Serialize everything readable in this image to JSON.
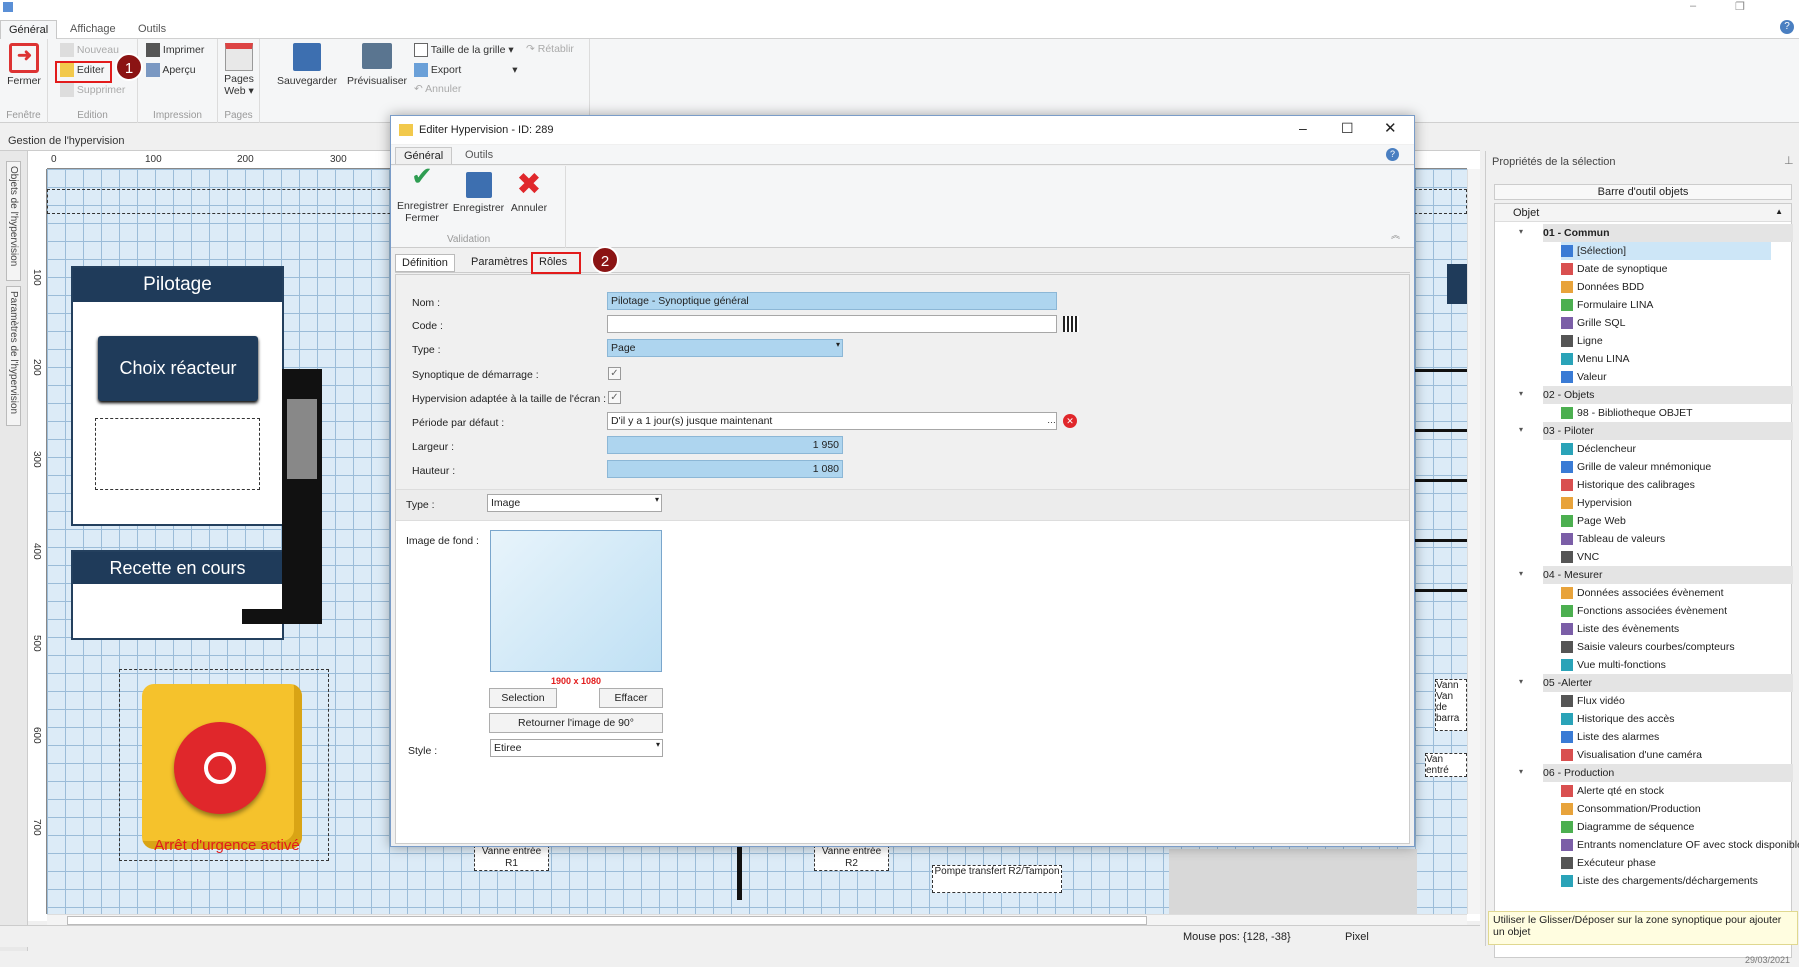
{
  "ribbon": {
    "tabs": [
      "Général",
      "Affichage",
      "Outils"
    ],
    "fermer": "Fermer",
    "nouveau": "Nouveau",
    "editer": "Editer",
    "supprimer": "Supprimer",
    "imprimer": "Imprimer",
    "apercu": "Aperçu",
    "pages_web": "Pages Web",
    "sauvegarder": "Sauvegarder",
    "previsualiser": "Prévisualiser",
    "taille_grille": "Taille de la grille",
    "export": "Export",
    "annuler": "Annuler",
    "retablir": "Rétablir",
    "groups": [
      "Fenêtre",
      "Edition",
      "Impression",
      "Pages"
    ]
  },
  "gestion": "Gestion de l'hypervision",
  "left_tabs": [
    "Objets de l'hypervision",
    "Paramètres de l'hypervision"
  ],
  "ruler": {
    "top": [
      "0",
      "100",
      "200",
      "300"
    ],
    "left": [
      "100",
      "200",
      "300",
      "400",
      "500",
      "600",
      "700"
    ]
  },
  "canvas": {
    "pilotage": "Pilotage",
    "choix": "Choix réacteur",
    "recette": "Recette en cours",
    "arret": "Arrêt d'urgence activé",
    "vanne_r1": "Vanne entrée R1",
    "vanne_r2": "Vanne entrée R2",
    "pompe": "Pompe transfert R2/Tampon",
    "vanne_right": "Vann Van de barra",
    "vanne_right2": "Van entré"
  },
  "status": {
    "mouse": "Mouse pos: {128, -38}",
    "unit": "Pixel"
  },
  "callouts": [
    "1",
    "2"
  ],
  "dialog": {
    "title": "Editer Hypervision - ID: 289",
    "tabs": [
      "Général",
      "Outils"
    ],
    "btn_save_close": "Enregistrer Fermer",
    "btn_save": "Enregistrer",
    "btn_cancel": "Annuler",
    "validation": "Validation",
    "subtabs": [
      "Définition",
      "Paramètres",
      "Rôles"
    ],
    "nom_label": "Nom :",
    "nom_value": "Pilotage - Synoptique général",
    "code_label": "Code :",
    "type_label": "Type :",
    "type_value": "Page",
    "demarrage_label": "Synoptique de démarrage :",
    "adaptee_label": "Hypervision adaptée à la taille de l'écran :",
    "periode_label": "Période par défaut :",
    "periode_value": "D'il y a 1 jour(s) jusque maintenant",
    "largeur_label": "Largeur :",
    "largeur_value": "1 950",
    "hauteur_label": "Hauteur :",
    "hauteur_value": "1 080",
    "type2_label": "Type :",
    "type2_value": "Image",
    "image_label": "Image de fond :",
    "image_size": "1900 x 1080",
    "selection": "Selection",
    "effacer": "Effacer",
    "retourner": "Retourner l'image de 90°",
    "style_label": "Style :",
    "style_value": "Etiree"
  },
  "rpanel": {
    "title": "Propriétés de la sélection",
    "toolbar": "Barre d'outil objets",
    "col": "Objet",
    "groups": [
      {
        "name": "01 - Commun",
        "items": [
          "[Sélection]",
          "Date de synoptique",
          "Données BDD",
          "Formulaire LINA",
          "Grille SQL",
          "Ligne",
          "Menu LINA",
          "Valeur"
        ]
      },
      {
        "name": "02 - Objets",
        "items": [
          "98 - Bibliotheque OBJET"
        ]
      },
      {
        "name": "03 - Piloter",
        "items": [
          "Déclencheur",
          "Grille de valeur mnémonique",
          "Historique des calibrages",
          "Hypervision",
          "Page Web",
          "Tableau de valeurs",
          "VNC"
        ]
      },
      {
        "name": "04 - Mesurer",
        "items": [
          "Données associées évènement",
          "Fonctions associées évènement",
          "Liste des évènements",
          "Saisie valeurs courbes/compteurs",
          "Vue multi-fonctions"
        ]
      },
      {
        "name": "05 -Alerter",
        "items": [
          "Flux vidéo",
          "Historique des accès",
          "Liste des alarmes",
          "Visualisation d'une caméra"
        ]
      },
      {
        "name": "06 - Production",
        "items": [
          "Alerte qté en stock",
          "Consommation/Production",
          "Diagramme de séquence",
          "Entrants nomenclature OF avec stock disponible",
          "Exécuteur phase",
          "Liste des chargements/déchargements"
        ]
      }
    ],
    "hint": "Utiliser le Glisser/Déposer sur la zone synoptique pour ajouter un objet"
  },
  "date": "29/03/2021",
  "colors": {
    "accent": "#2b6cb0",
    "selection": "#aed5ef",
    "callout": "#8b1414",
    "highlight": "#e21b1b"
  }
}
